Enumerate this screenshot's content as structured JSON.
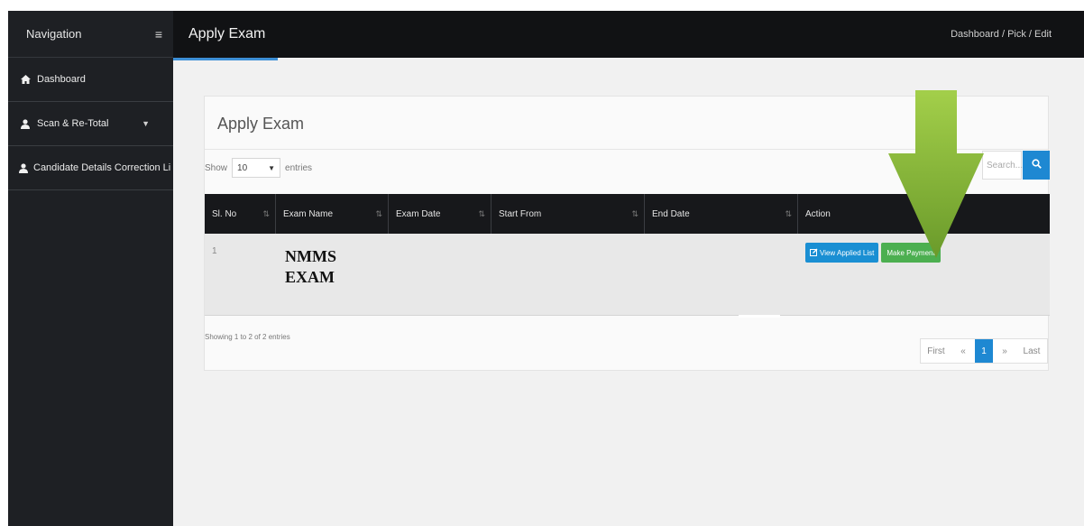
{
  "sidebar": {
    "title": "Navigation",
    "items": [
      {
        "label": "Dashboard",
        "icon": "home-icon"
      },
      {
        "label": "Scan & Re-Total",
        "icon": "user-icon",
        "has_submenu": true
      },
      {
        "label": "Candidate Details Correction Li",
        "icon": "user-icon"
      }
    ]
  },
  "header": {
    "title": "Apply Exam",
    "breadcrumb": "Dashboard  /  Pick  /  Edit"
  },
  "card": {
    "title": "Apply Exam",
    "show_label": "Show",
    "entries_value": "10",
    "entries_label": "entries",
    "search_placeholder": "Search..."
  },
  "table": {
    "columns": [
      "Sl. No",
      "Exam Name",
      "Exam Date",
      "Start From",
      "End Date",
      "Action"
    ],
    "rows": [
      {
        "sl": "1",
        "exam_name_line1": "NMMS",
        "exam_name_line2": "EXAM",
        "exam_date": "",
        "start_from": "",
        "end_date": ""
      }
    ],
    "view_button": "View Applied List",
    "pay_button": "Make Payment"
  },
  "footer": {
    "info": "Showing 1 to 2 of 2 entries",
    "pager": {
      "first": "First",
      "prev": "«",
      "current": "1",
      "next": "»",
      "last": "Last"
    }
  },
  "colors": {
    "accent_blue": "#1e88d2",
    "pay_green": "#4caf50",
    "arrow_green": "#8dc63f",
    "sidebar_bg": "#1e2024"
  }
}
